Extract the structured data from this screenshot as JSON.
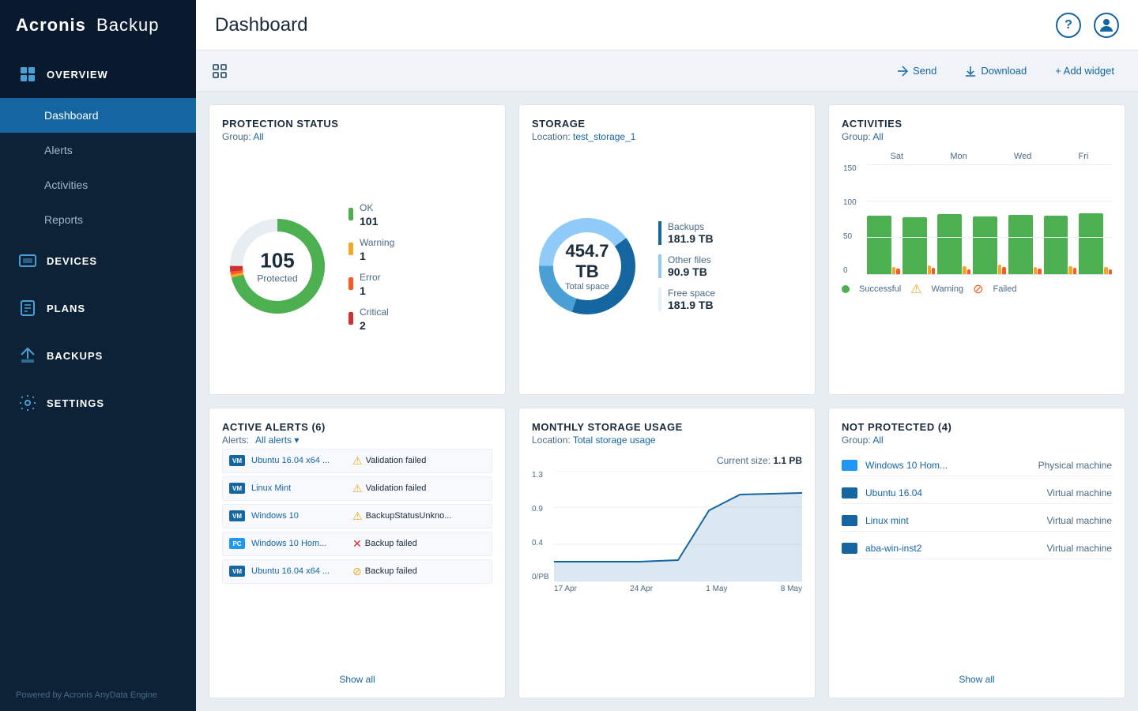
{
  "app": {
    "logo_acronis": "Acronis",
    "logo_backup": "Backup",
    "footer": "Powered by Acronis AnyData Engine"
  },
  "sidebar": {
    "overview_label": "OVERVIEW",
    "items": [
      {
        "id": "dashboard",
        "label": "Dashboard",
        "active": true
      },
      {
        "id": "alerts",
        "label": "Alerts",
        "active": false
      },
      {
        "id": "activities",
        "label": "Activities",
        "active": false
      },
      {
        "id": "reports",
        "label": "Reports",
        "active": false
      }
    ],
    "nav_items": [
      {
        "id": "devices",
        "label": "DEVICES"
      },
      {
        "id": "plans",
        "label": "PLANS"
      },
      {
        "id": "backups",
        "label": "BACKUPS"
      },
      {
        "id": "settings",
        "label": "SETTINGS"
      }
    ]
  },
  "topbar": {
    "title": "Dashboard",
    "help_icon": "?",
    "user_icon": "👤"
  },
  "toolbar": {
    "send_label": "Send",
    "download_label": "Download",
    "add_widget_label": "+ Add widget"
  },
  "protection_status": {
    "title": "PROTECTION STATUS",
    "group_label": "Group:",
    "group_value": "All",
    "total_number": "105",
    "total_label": "Protected",
    "statuses": [
      {
        "id": "ok",
        "label": "OK",
        "value": "101",
        "color": "#4caf50"
      },
      {
        "id": "warning",
        "label": "Warning",
        "value": "1",
        "color": "#f5a623"
      },
      {
        "id": "error",
        "label": "Error",
        "value": "1",
        "color": "#ff5722"
      },
      {
        "id": "critical",
        "label": "Critical",
        "value": "2",
        "color": "#d32f2f"
      }
    ],
    "donut": {
      "ok_pct": 96,
      "warning_pct": 1,
      "error_pct": 1,
      "critical_pct": 2
    }
  },
  "storage": {
    "title": "STORAGE",
    "location_label": "Location:",
    "location_value": "test_storage_1",
    "total_tb": "454.7 TB",
    "total_label": "Total space",
    "legend": [
      {
        "id": "backups",
        "label": "Backups",
        "value": "181.9 TB",
        "color": "#1565a0"
      },
      {
        "id": "other",
        "label": "Other files",
        "value": "90.9 TB",
        "color": "#90caf9"
      },
      {
        "id": "free",
        "label": "Free space",
        "value": "181.9 TB",
        "color": "#e3f2fd"
      }
    ]
  },
  "activities": {
    "title": "ACTIVITIES",
    "group_label": "Group:",
    "group_value": "All",
    "days": [
      "Sat",
      "Mon",
      "Wed",
      "Fri"
    ],
    "y_labels": [
      "150",
      "100",
      "50",
      "0"
    ],
    "bars": [
      {
        "successful": 80,
        "warning": 10,
        "failed": 8
      },
      {
        "successful": 78,
        "warning": 12,
        "failed": 9
      },
      {
        "successful": 82,
        "warning": 11,
        "failed": 7
      },
      {
        "successful": 79,
        "warning": 13,
        "failed": 10
      },
      {
        "successful": 81,
        "warning": 10,
        "failed": 8
      },
      {
        "successful": 80,
        "warning": 11,
        "failed": 9
      },
      {
        "successful": 83,
        "warning": 10,
        "failed": 7
      }
    ],
    "legend": [
      {
        "id": "successful",
        "label": "Successful",
        "color": "#4caf50"
      },
      {
        "id": "warning",
        "label": "Warning",
        "color": "#f5a623"
      },
      {
        "id": "failed",
        "label": "Failed",
        "color": "#ff5722"
      }
    ]
  },
  "active_alerts": {
    "title": "ACTIVE ALERTS",
    "count": 6,
    "filter_label": "Alerts:",
    "filter_value": "All alerts",
    "rows": [
      {
        "id": "row1",
        "device": "Ubuntu 16.04 x64 ...",
        "status": "Validation failed",
        "type": "warning",
        "icon": "vm"
      },
      {
        "id": "row2",
        "device": "Linux Mint",
        "status": "Validation failed",
        "type": "warning",
        "icon": "vm"
      },
      {
        "id": "row3",
        "device": "Windows 10",
        "status": "BackupStatusUnkno...",
        "type": "warning",
        "icon": "vm"
      },
      {
        "id": "row4",
        "device": "Windows 10 Hom...",
        "status": "Backup failed",
        "type": "error",
        "icon": "physical"
      },
      {
        "id": "row5",
        "device": "Ubuntu 16.04 x64 ...",
        "status": "Backup failed",
        "type": "orangeerror",
        "icon": "vm"
      }
    ],
    "show_all_label": "Show all"
  },
  "monthly_storage": {
    "title": "MONTHLY STORAGE USAGE",
    "location_label": "Location:",
    "location_value": "Total storage usage",
    "current_size_label": "Current size:",
    "current_size_value": "1.1 PB",
    "y_labels": [
      "1.3",
      "0.9",
      "0.4",
      "0/PB"
    ],
    "x_labels": [
      "17 Apr",
      "24 Apr",
      "1 May",
      "8 May"
    ]
  },
  "not_protected": {
    "title": "NOT PROTECTED",
    "count": 4,
    "group_label": "Group:",
    "group_value": "All",
    "rows": [
      {
        "id": "np1",
        "device": "Windows 10 Hom...",
        "type": "Physical machine",
        "icon": "physical",
        "color": "#2196f3"
      },
      {
        "id": "np2",
        "device": "Ubuntu 16.04",
        "type": "Virtual machine",
        "icon": "vm",
        "color": "#1565a0"
      },
      {
        "id": "np3",
        "device": "Linux mint",
        "type": "Virtual machine",
        "icon": "vm",
        "color": "#1565a0"
      },
      {
        "id": "np4",
        "device": "aba-win-inst2",
        "type": "Virtual machine",
        "icon": "vm",
        "color": "#1565a0"
      }
    ],
    "show_all_label": "Show all"
  }
}
